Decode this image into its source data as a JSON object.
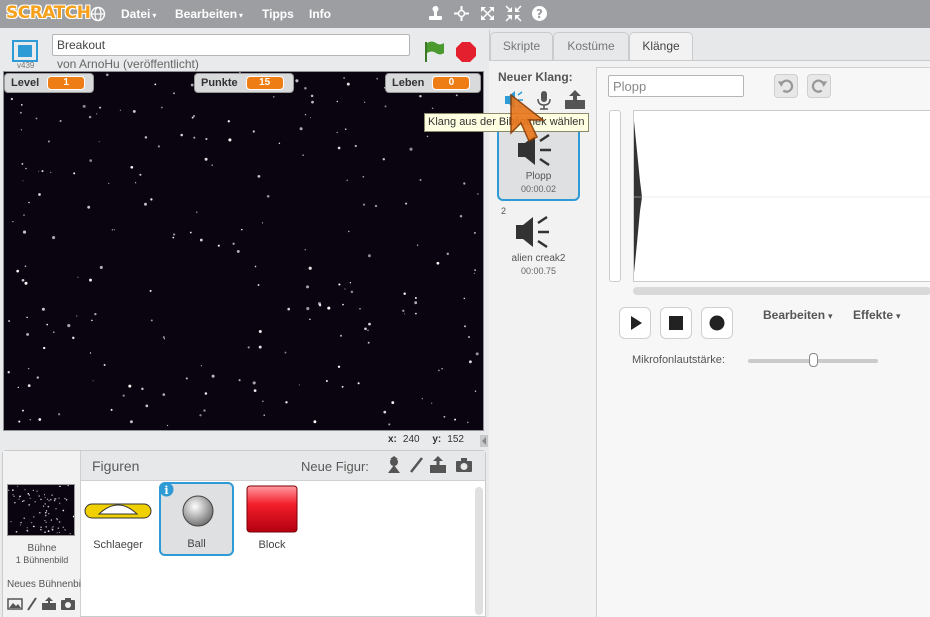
{
  "menubar": {
    "logo": "SCRATCH",
    "items": [
      {
        "label": "Datei",
        "caret": "▾"
      },
      {
        "label": "Bearbeiten",
        "caret": "▾"
      },
      {
        "label": "Tipps"
      },
      {
        "label": "Info"
      }
    ],
    "tools": [
      "duplicate-stamp-icon",
      "cut-scissors-icon",
      "grow-icon",
      "shrink-icon",
      "help-icon"
    ]
  },
  "project": {
    "version": "v439",
    "title": "Breakout",
    "byline": "von ArnoHu (veröffentlicht)"
  },
  "stage": {
    "monitors": [
      {
        "label": "Level",
        "value": "1"
      },
      {
        "label": "Punkte",
        "value": "15"
      },
      {
        "label": "Leben",
        "value": "0"
      }
    ],
    "background_color": "#0a0410"
  },
  "coords": {
    "x_label": "x:",
    "x": "240",
    "y_label": "y:",
    "y": "152"
  },
  "sprites": {
    "title": "Figuren",
    "new_sprite_label": "Neue Figur:",
    "stage_name": "Bühne",
    "stage_backdrops": "1 Bühnenbild",
    "new_backdrop_label": "Neues Bühnenbild:",
    "items": [
      {
        "name": "Schlaeger",
        "selected": false
      },
      {
        "name": "Ball",
        "selected": true
      },
      {
        "name": "Block",
        "selected": false
      }
    ]
  },
  "tabs": [
    {
      "label": "Skripte",
      "active": false
    },
    {
      "label": "Kostüme",
      "active": false
    },
    {
      "label": "Klänge",
      "active": true
    }
  ],
  "sounds": {
    "new_sound_label": "Neuer Klang:",
    "items": [
      {
        "index": "1",
        "name": "Plopp",
        "duration": "00:00.02",
        "selected": true
      },
      {
        "index": "2",
        "name": "alien creak2",
        "duration": "00:00.75",
        "selected": false
      }
    ]
  },
  "editor": {
    "sound_name": "Plopp",
    "menus": [
      {
        "label": "Bearbeiten",
        "caret": "▾"
      },
      {
        "label": "Effekte",
        "caret": "▾"
      }
    ],
    "mic_label": "Mikrofonlautstärke:",
    "mic_level": 0.5
  },
  "tooltip": "Klang aus der Bibliothek wählen",
  "colors": {
    "menubar": "#9c9ea2",
    "accent_orange": "#ee7d16",
    "selection_blue": "#2e9bd6",
    "flag_green": "#4b9a2f",
    "stop_red": "#e4202e"
  }
}
